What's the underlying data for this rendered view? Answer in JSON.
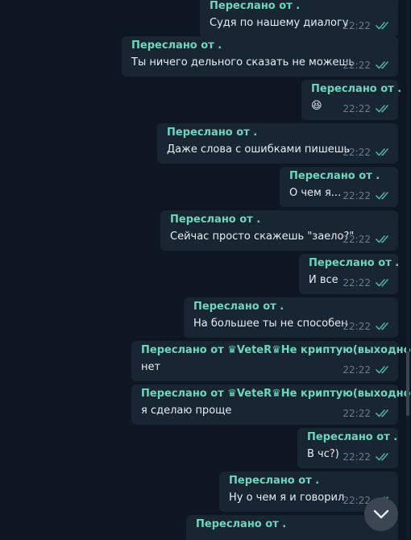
{
  "messages": [
    {
      "forwarded": "Переслано от .",
      "text": "Судя по нашему диалогу",
      "time": "22:22"
    },
    {
      "forwarded": "Переслано от .",
      "text": "Ты ничего дельного сказать не можешь",
      "time": "22:22"
    },
    {
      "forwarded": "Переслано от .",
      "text": "😆",
      "time": "22:22"
    },
    {
      "forwarded": "Переслано от .",
      "text": "Даже слова с ошибками пишешь",
      "time": "22:22"
    },
    {
      "forwarded": "Переслано от .",
      "text": "О чем я...",
      "time": "22:22"
    },
    {
      "forwarded": "Переслано от .",
      "text": "Сейчас просто скажешь \"заело?\"",
      "time": "22:22"
    },
    {
      "forwarded": "Переслано от .",
      "text": "И все",
      "time": "22:22"
    },
    {
      "forwarded": "Переслано от .",
      "text": "На большее ты не способен",
      "time": "22:22"
    },
    {
      "forwarded": "Переслано от ♛VeteR♛Не криптую(выходной)",
      "text": "нет",
      "time": "22:22"
    },
    {
      "forwarded": "Переслано от ♛VeteR♛Не криптую(выходной)",
      "text": "я сделаю проще",
      "time": "22:22"
    },
    {
      "forwarded": "Переслано от .",
      "text": "В чс?)",
      "time": "22:22"
    },
    {
      "forwarded": "Переслано от .",
      "text": "Ну о чем я и говорил",
      "time": "22:22"
    },
    {
      "forwarded": "Переслано от .",
      "text": "",
      "time": ""
    }
  ],
  "colors": {
    "background": "#0e1621",
    "bubble": "#182533",
    "forward_label": "#6ed6b9",
    "message_text": "#e8edf2",
    "time": "#6a7b8c",
    "read_ticks": "#4fae9b"
  },
  "icons": {
    "read_receipt": "double-check-icon",
    "scroll_down": "chevron-down-icon"
  }
}
